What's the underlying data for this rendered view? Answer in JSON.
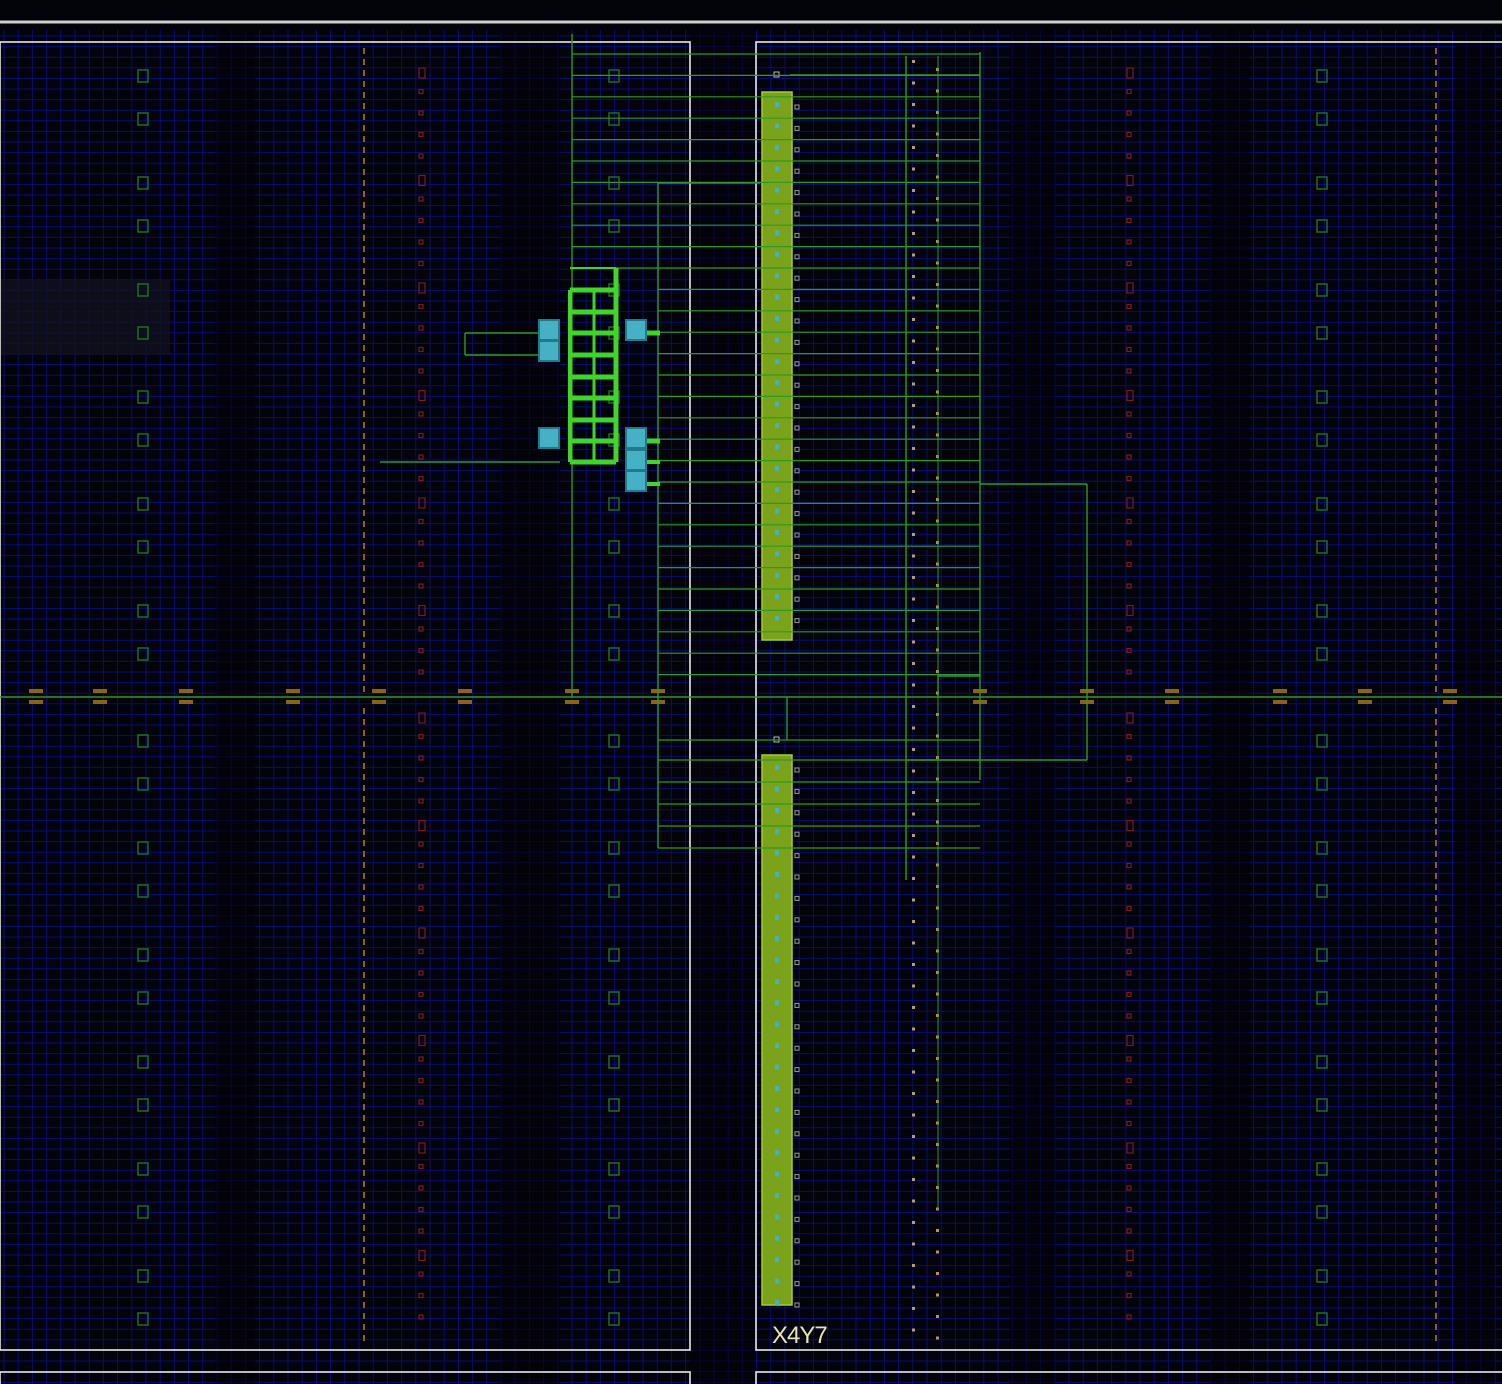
{
  "view": {
    "clock_region_label": "X4Y7"
  },
  "colors": {
    "background": "#03030a",
    "grid_minor": "#0b0b7a",
    "grid_major": "#1a1ab0",
    "region_border": "#e8e8e8",
    "top_border": "#d0d0d0",
    "net": "#2f9a22",
    "net_bright": "#3fd52a",
    "block_memory": "#7aa21a",
    "block_edge": "#a6cc2a",
    "cell_placed": "#46b0c4",
    "cell_placed_dark": "#1f7a8c",
    "site_green": "#1f6e1f",
    "site_red": "#7a1c1c",
    "site_amber": "#8a6414",
    "label_text": "#e9e3b0"
  },
  "icons": {
    "placed_cell": "square-cell-icon",
    "io_site": "amber-dash-icon"
  }
}
